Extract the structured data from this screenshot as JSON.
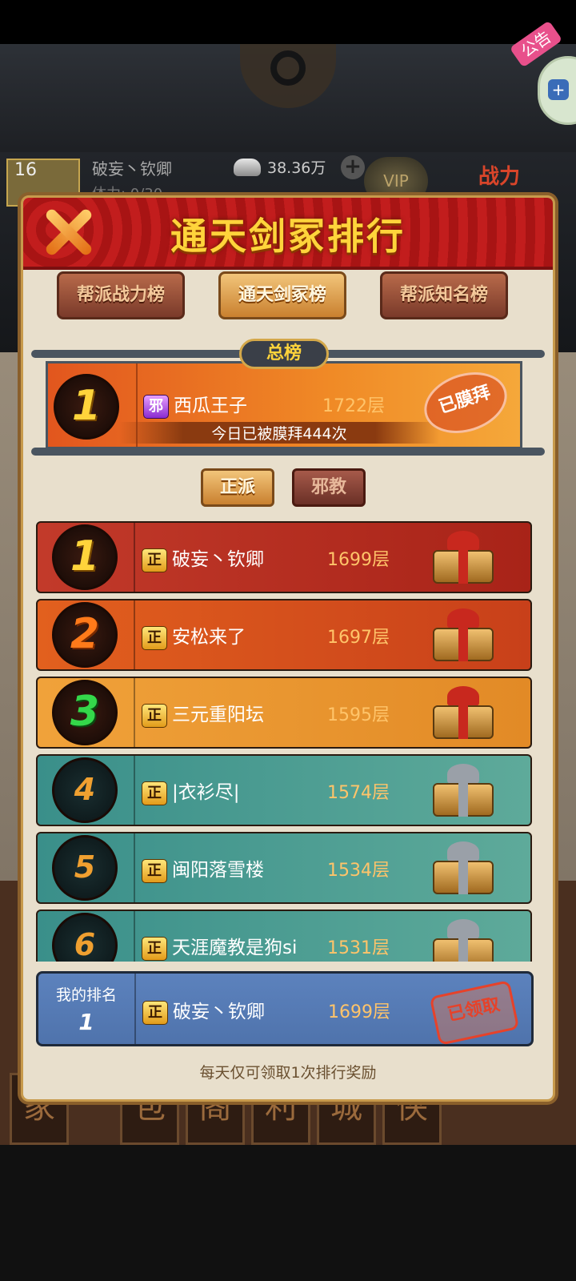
{
  "background": {
    "player_name": "破妄丶钦卿",
    "player_level": "16",
    "stamina": "体力: 0/30",
    "silver": "38.36万",
    "vip": "VIP",
    "power_label": "战力",
    "notice": "公告",
    "bottom_tabs": [
      "家",
      "包",
      "阁",
      "利",
      "城",
      "侠"
    ]
  },
  "modal": {
    "title": "通天剑冢排行",
    "tabs": [
      "帮派战力榜",
      "通天剑冢榜",
      "帮派知名榜"
    ],
    "active_tab": 1,
    "overall_label": "总榜",
    "top_entry": {
      "rank": "1",
      "faction": "邪",
      "name": "西瓜王子",
      "value": "1722层",
      "worship_text": "今日已被膜拜444次",
      "stamp": "已膜拜"
    },
    "faction_tabs": [
      "正派",
      "邪教"
    ],
    "entries": [
      {
        "rank": "1",
        "faction": "正",
        "name": "破妄丶钦卿",
        "value": "1699层",
        "gift": "red"
      },
      {
        "rank": "2",
        "faction": "正",
        "name": "安松来了",
        "value": "1697层",
        "gift": "red"
      },
      {
        "rank": "3",
        "faction": "正",
        "name": "三元重阳坛",
        "value": "1595层",
        "gift": "red"
      },
      {
        "rank": "4",
        "faction": "正",
        "name": "|衣衫尽|",
        "value": "1574层",
        "gift": "silver"
      },
      {
        "rank": "5",
        "faction": "正",
        "name": "闽阳落雪楼",
        "value": "1534层",
        "gift": "silver"
      },
      {
        "rank": "6",
        "faction": "正",
        "name": "天涯魔教是狗si",
        "value": "1531层",
        "gift": "silver"
      }
    ],
    "my_rank": {
      "label": "我的排名",
      "rank": "1",
      "faction": "正",
      "name": "破妄丶钦卿",
      "value": "1699层",
      "stamp": "已领取"
    },
    "footer": "每天仅可领取1次排行奖励"
  },
  "colors": {
    "row1": "#b8322a",
    "row2": "#d9531e",
    "row3": "#e8902e",
    "teal": "#3f9a94",
    "my_rank": "#5576ae",
    "accent_gold": "#ffd43b"
  }
}
